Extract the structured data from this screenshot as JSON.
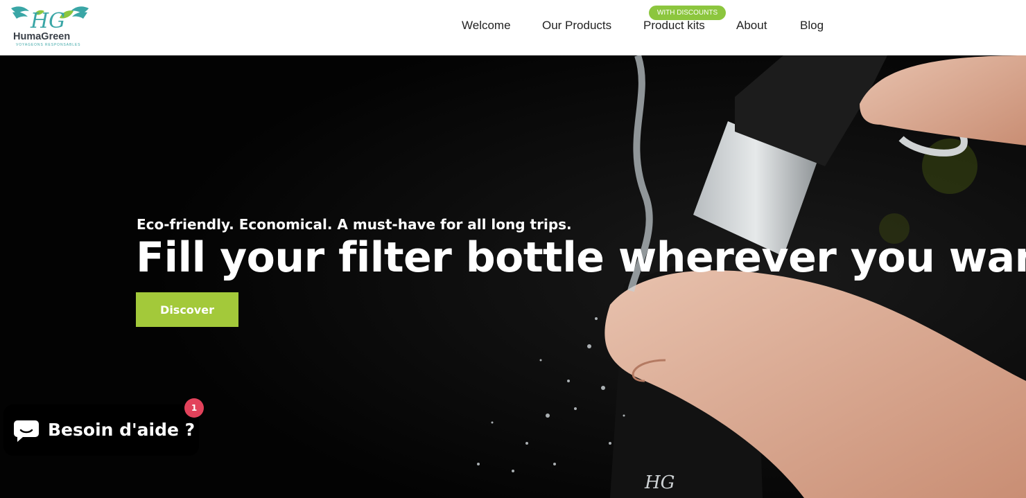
{
  "brand": {
    "name": "HumaGreen",
    "monogram": "HG",
    "tagline": "VOYAGEONS RESPONSABLES",
    "colors": {
      "primary": "#3aa6a6",
      "leaf": "#8cc63e",
      "text": "#3a4048"
    }
  },
  "nav": {
    "items": [
      {
        "label": "Welcome"
      },
      {
        "label": "Our Products"
      },
      {
        "label": "Product kits",
        "badge": "WITH DISCOUNTS"
      },
      {
        "label": "About"
      },
      {
        "label": "Blog"
      }
    ]
  },
  "hero": {
    "tagline": "Eco-friendly. Economical. A must-have for all long trips.",
    "title": "Fill your filter bottle wherever you want",
    "cta_label": "Discover",
    "cta_color": "#a3c93a"
  },
  "chat": {
    "label": "Besoin d'aide ?",
    "unread_count": "1",
    "icon": "chat-bubble-icon",
    "badge_color": "#e2425b"
  }
}
